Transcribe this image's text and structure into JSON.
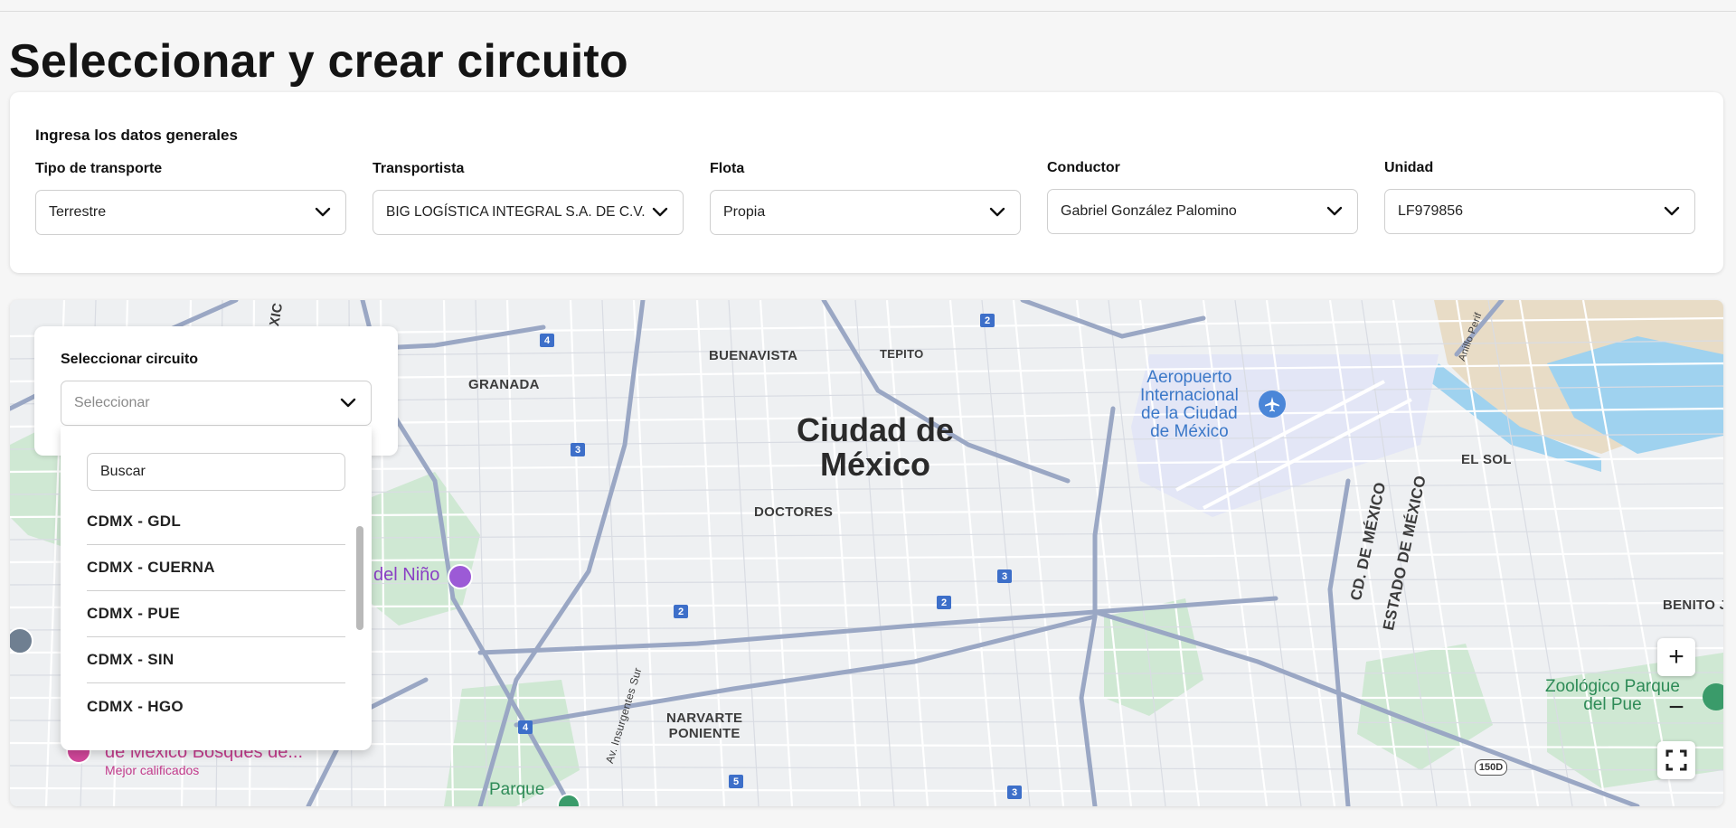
{
  "page": {
    "title": "Seleccionar y crear circuito"
  },
  "general": {
    "section_title": "Ingresa los datos generales",
    "fields": [
      {
        "label": "Tipo de transporte",
        "value": "Terrestre"
      },
      {
        "label": "Transportista",
        "value": "BIG LOGÍSTICA INTEGRAL S.A. DE C.V."
      },
      {
        "label": "Flota",
        "value": "Propia"
      },
      {
        "label": "Conductor",
        "value": "Gabriel González Palomino"
      },
      {
        "label": "Unidad",
        "value": "LF979856"
      }
    ]
  },
  "circuit": {
    "label": "Seleccionar circuito",
    "placeholder": "Seleccionar",
    "search_value": "Buscar",
    "options": [
      "CDMX - GDL",
      "CDMX - CUERNA",
      "CDMX - PUE",
      "CDMX - SIN",
      "CDMX - HGO"
    ]
  },
  "map": {
    "labels": {
      "city": [
        "Ciudad de",
        "México"
      ],
      "granada": "GRANADA",
      "buenavista": "BUENAVISTA",
      "tepito": "TEPITO",
      "doctores": "DOCTORES",
      "narvarte": [
        "NARVARTE",
        "PONIENTE"
      ],
      "el_sol": "EL SOL",
      "benito": "BENITO JUÁ",
      "airport": [
        "Aeropuerto",
        "Internacional",
        "de la Ciudad",
        "de México"
      ],
      "zoo": [
        "Zoológico Parque",
        "del Pue"
      ],
      "nino": "del Niño",
      "cd_mexico": "CD. DE MÉXICO",
      "estado_mexico": "ESTADO DE MÉXICO",
      "insurgentes": "Av. Insurgentes Sur",
      "bosques": "de México Bosques de...",
      "mejor": "Mejor calificados",
      "parque": "Parque",
      "mexico_frag": "MÉXIC",
      "anillo": "Anillo Perif",
      "hwy": "150D"
    },
    "shields": [
      "4",
      "3",
      "2",
      "2",
      "2",
      "3",
      "4",
      "5",
      "3"
    ],
    "controls": {
      "zoom_in": "+",
      "zoom_out": "−"
    }
  }
}
